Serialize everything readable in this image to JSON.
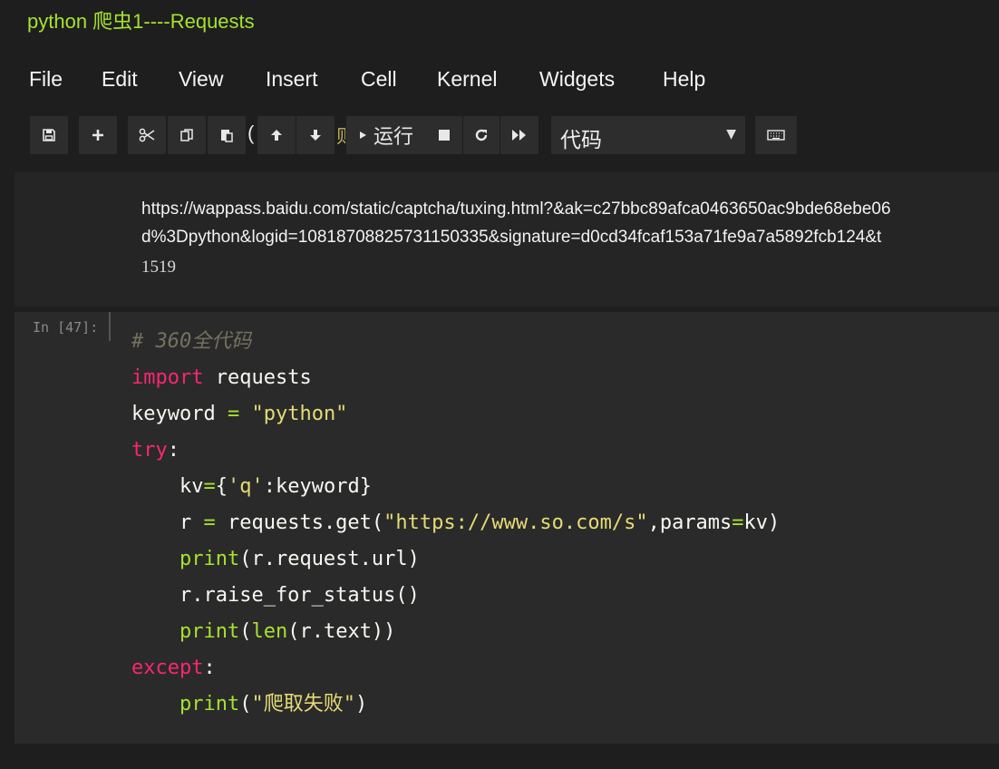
{
  "notebook": {
    "title": "python 爬虫1----Requests"
  },
  "menu": [
    "File",
    "Edit",
    "View",
    "Insert",
    "Cell",
    "Kernel",
    "Widgets",
    "Help"
  ],
  "toolbar": {
    "partial_label_1": "(",
    "partial_label_2": "则",
    "run_label": "运行",
    "cell_type": "代码",
    "icons": [
      "save-icon",
      "plus-icon",
      "cut-icon",
      "copy-icon",
      "paste-icon",
      "arrow-up-icon",
      "arrow-down-icon",
      "run-icon",
      "stop-icon",
      "restart-icon",
      "fast-forward-icon",
      "keyboard-icon"
    ]
  },
  "output": {
    "line1": "https://wappass.baidu.com/static/captcha/tuxing.html?&ak=c27bbc89afca0463650ac9bde68ebe06",
    "line2": "d%3Dpython&logid=10818708825731150335&signature=d0cd34fcaf153a71fe9a7a5892fcb124&t",
    "length": "1519"
  },
  "cell": {
    "prompt": "In [47]:",
    "code": {
      "l1": "# 360全代码",
      "l2_kw": "import",
      "l2_rest": " requests",
      "l3_a": "keyword ",
      "l3_op": "=",
      "l3_sp": " ",
      "l3_str": "\"python\"",
      "l4_kw": "try",
      "l4_rest": ":",
      "l5_a": "    kv",
      "l5_op": "=",
      "l5_b": "{",
      "l5_str": "'q'",
      "l5_c": ":keyword}",
      "l6_a": "    r ",
      "l6_op": "=",
      "l6_b": " requests.get(",
      "l6_str": "\"https://www.so.com/s\"",
      "l6_c": ",params",
      "l6_op2": "=",
      "l6_d": "kv)",
      "l7_fn": "    print",
      "l7_rest": "(r.request.url)",
      "l8": "    r.raise_for_status()",
      "l9_fn": "    print",
      "l9_a": "(",
      "l9_fn2": "len",
      "l9_b": "(r.text))",
      "l10_kw": "except",
      "l10_rest": ":",
      "l11_fn": "    print",
      "l11_a": "(",
      "l11_str": "\"爬取失败\"",
      "l11_b": ")"
    }
  }
}
